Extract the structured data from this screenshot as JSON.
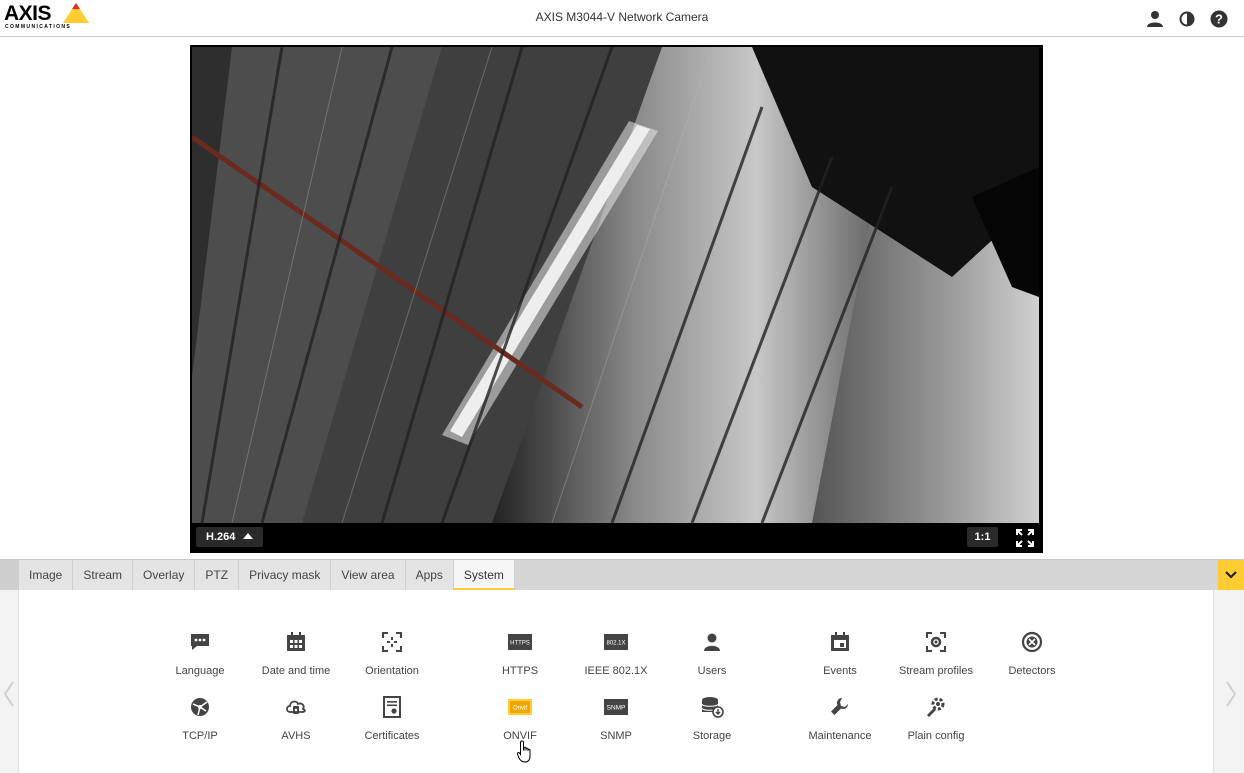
{
  "header": {
    "logo_text": "AXIS",
    "logo_sub": "COMMUNICATIONS",
    "title": "AXIS M3044-V Network Camera",
    "icons": [
      "user-icon",
      "contrast-icon",
      "help-icon"
    ]
  },
  "video": {
    "codec_label": "H.264",
    "zoom_label": "1:1",
    "fullscreen_icon": "fullscreen-icon"
  },
  "tabs": [
    {
      "label": "Image"
    },
    {
      "label": "Stream"
    },
    {
      "label": "Overlay"
    },
    {
      "label": "PTZ"
    },
    {
      "label": "Privacy mask"
    },
    {
      "label": "View area"
    },
    {
      "label": "Apps"
    },
    {
      "label": "System"
    }
  ],
  "active_tab": "System",
  "system_items": {
    "row1": [
      {
        "label": "Language",
        "icon": "language-icon"
      },
      {
        "label": "Date and time",
        "icon": "calendar-icon"
      },
      {
        "label": "Orientation",
        "icon": "orientation-icon"
      },
      {
        "label": "HTTPS",
        "icon": "https-icon",
        "icon_text": "HTTPS"
      },
      {
        "label": "IEEE 802.1X",
        "icon": "ieee-icon",
        "icon_text": "802.1X"
      },
      {
        "label": "Users",
        "icon": "user-icon"
      },
      {
        "label": "Events",
        "icon": "calendar-event-icon"
      },
      {
        "label": "Stream profiles",
        "icon": "stream-profile-icon"
      },
      {
        "label": "Detectors",
        "icon": "detector-icon"
      }
    ],
    "row2": [
      {
        "label": "TCP/IP",
        "icon": "network-icon"
      },
      {
        "label": "AVHS",
        "icon": "cloud-icon"
      },
      {
        "label": "Certificates",
        "icon": "certificate-icon"
      },
      {
        "label": "ONVIF",
        "icon": "onvif-icon",
        "icon_text": "Onvif"
      },
      {
        "label": "SNMP",
        "icon": "snmp-icon",
        "icon_text": "SNMP"
      },
      {
        "label": "Storage",
        "icon": "storage-icon"
      },
      {
        "label": "Maintenance",
        "icon": "wrench-icon"
      },
      {
        "label": "Plain config",
        "icon": "config-icon"
      }
    ]
  },
  "colors": {
    "accent": "#ffcc33",
    "icon": "#444444"
  }
}
